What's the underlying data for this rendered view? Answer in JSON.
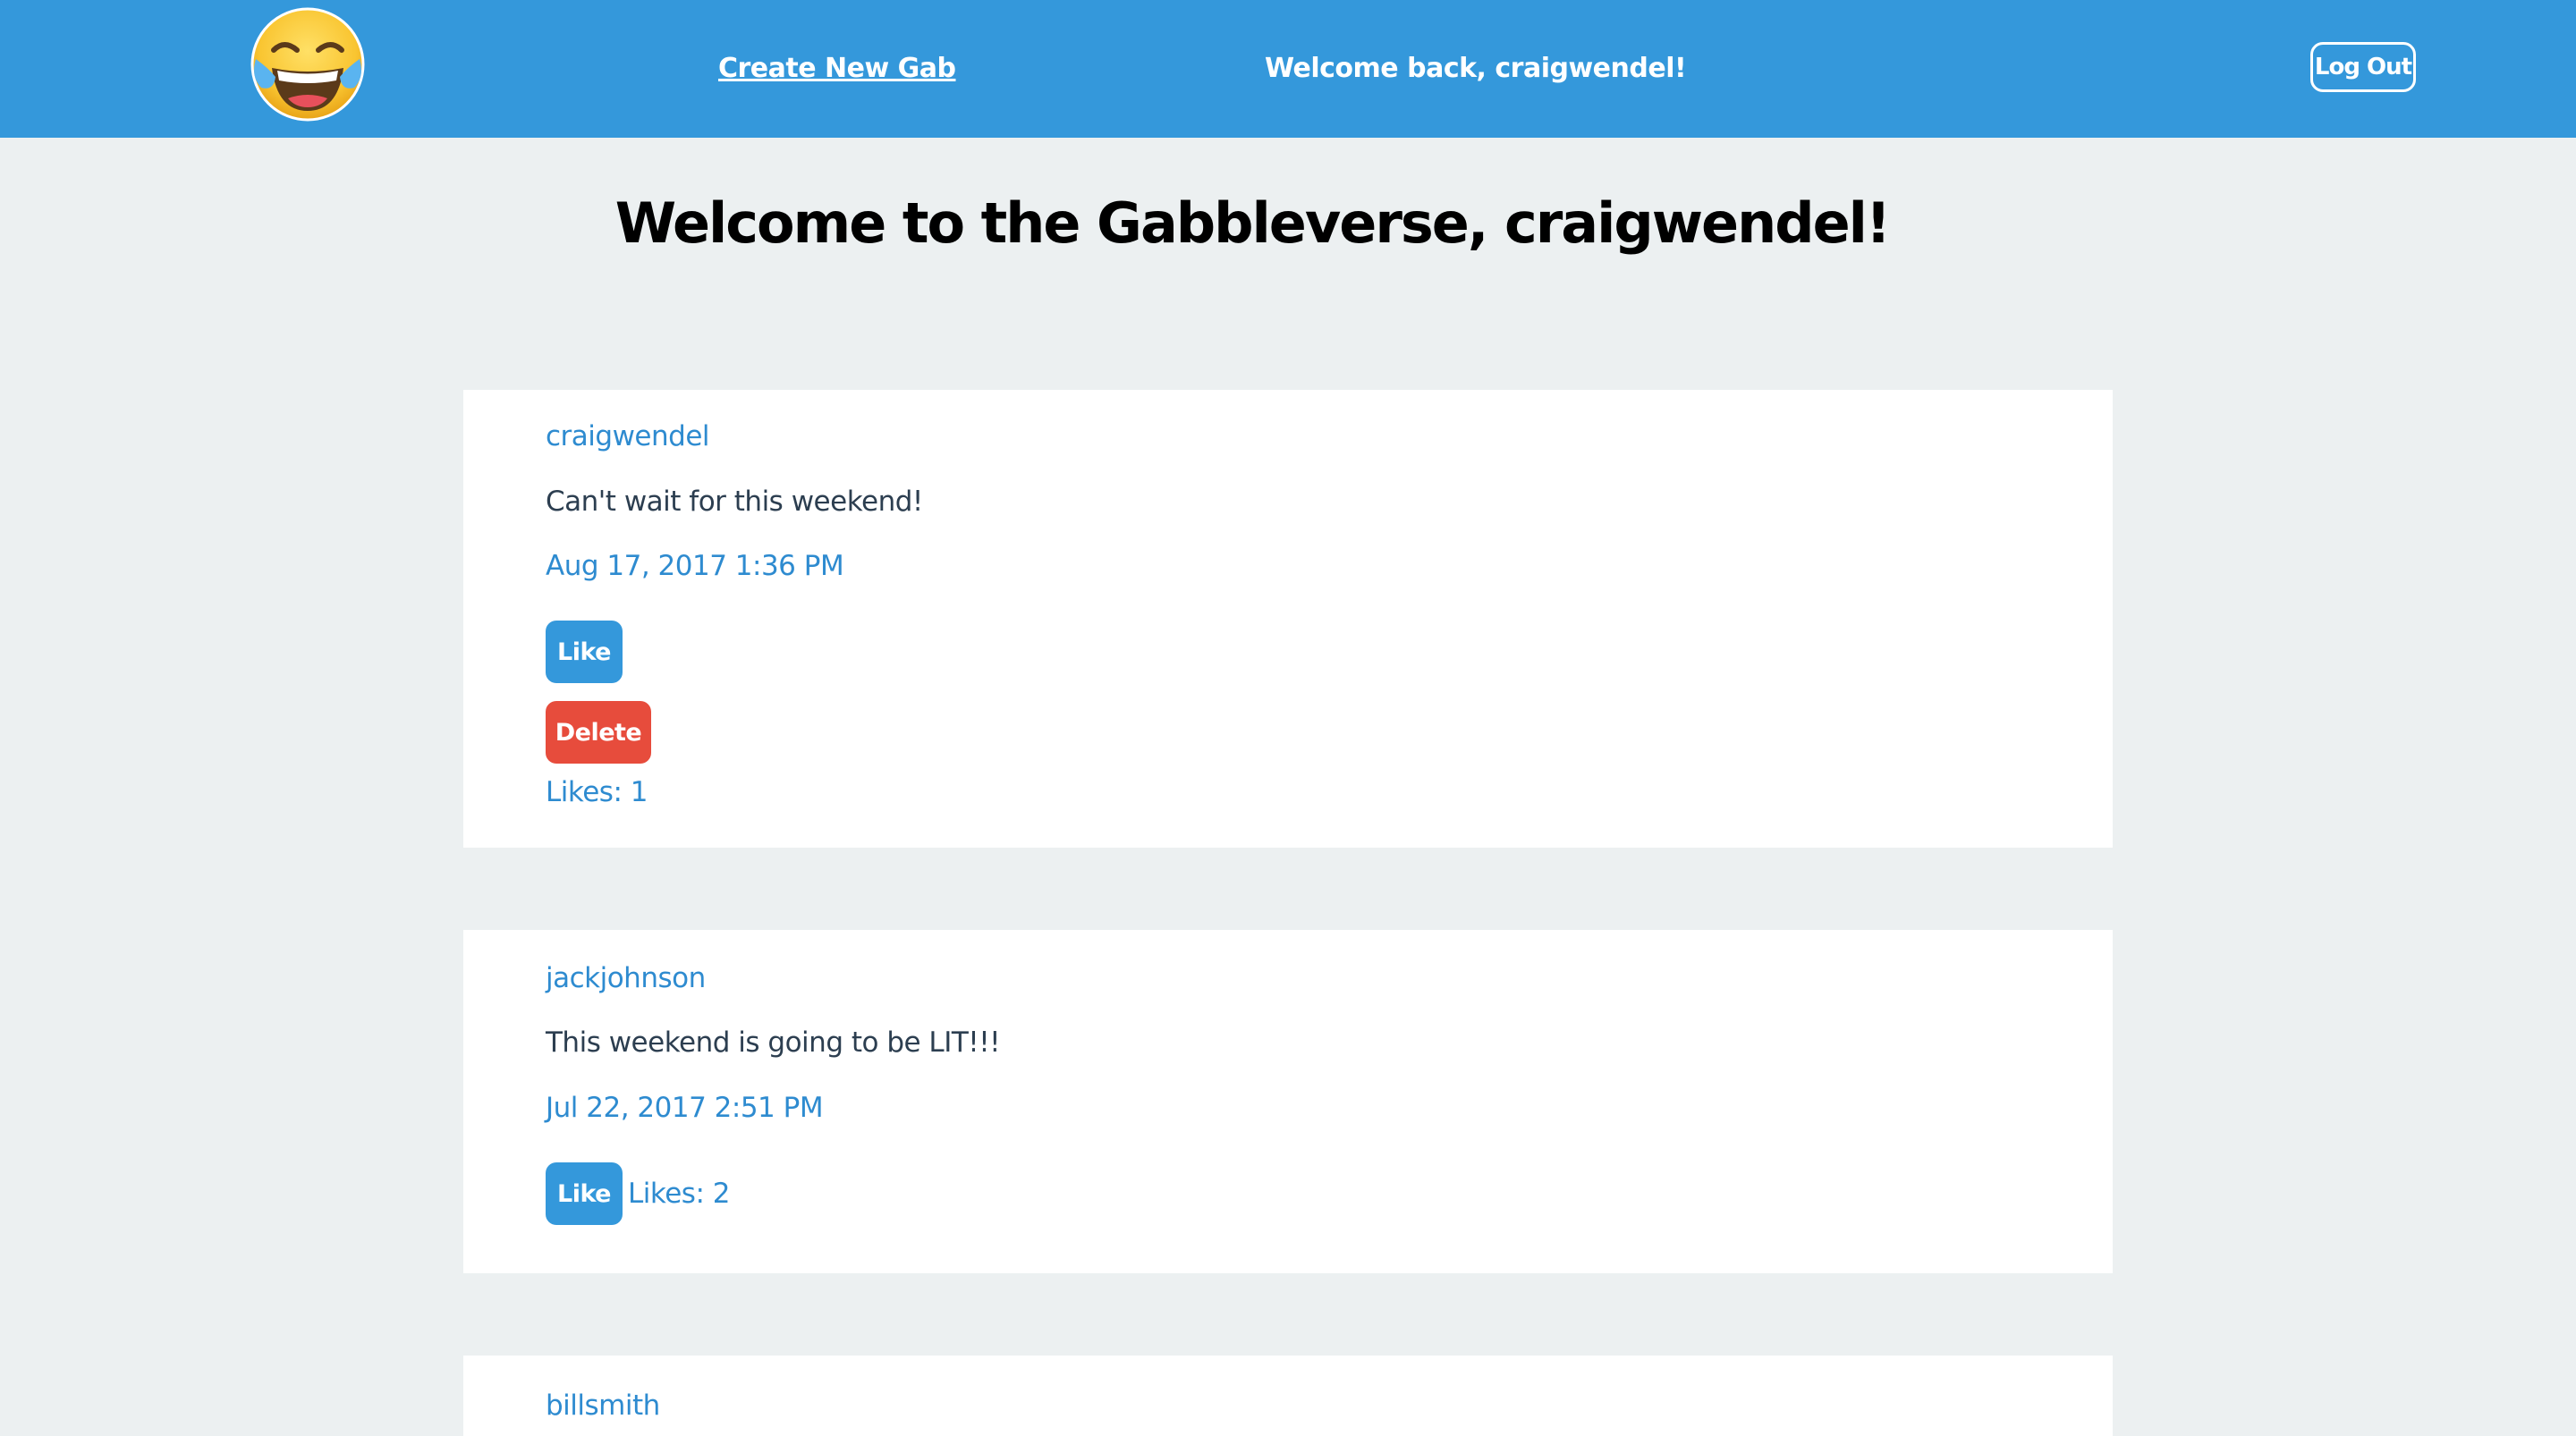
{
  "nav": {
    "create_link": "Create New Gab",
    "welcome": "Welcome back, craigwendel!",
    "logout_label": "Log Out"
  },
  "page_title": "Welcome to the Gabbleverse, craigwendel!",
  "posts": [
    {
      "author": "craigwendel",
      "body": "Can't wait for this weekend!",
      "timestamp": "Aug 17, 2017 1:36 PM",
      "like_label": "Like",
      "delete_label": "Delete",
      "likes": "Likes: 1"
    },
    {
      "author": "jackjohnson",
      "body": "This weekend is going to be LIT!!!",
      "timestamp": "Jul 22, 2017 2:51 PM",
      "like_label": "Like",
      "likes": "Likes: 2"
    },
    {
      "author": "billsmith"
    }
  ],
  "colors": {
    "navbar": "#3498db",
    "background": "#ecf0f1",
    "link_blue": "#2e8bd0",
    "like_button": "#3498db",
    "delete_button": "#e74c3c"
  },
  "icons": {
    "logo": "face-with-tears-of-joy-icon"
  }
}
